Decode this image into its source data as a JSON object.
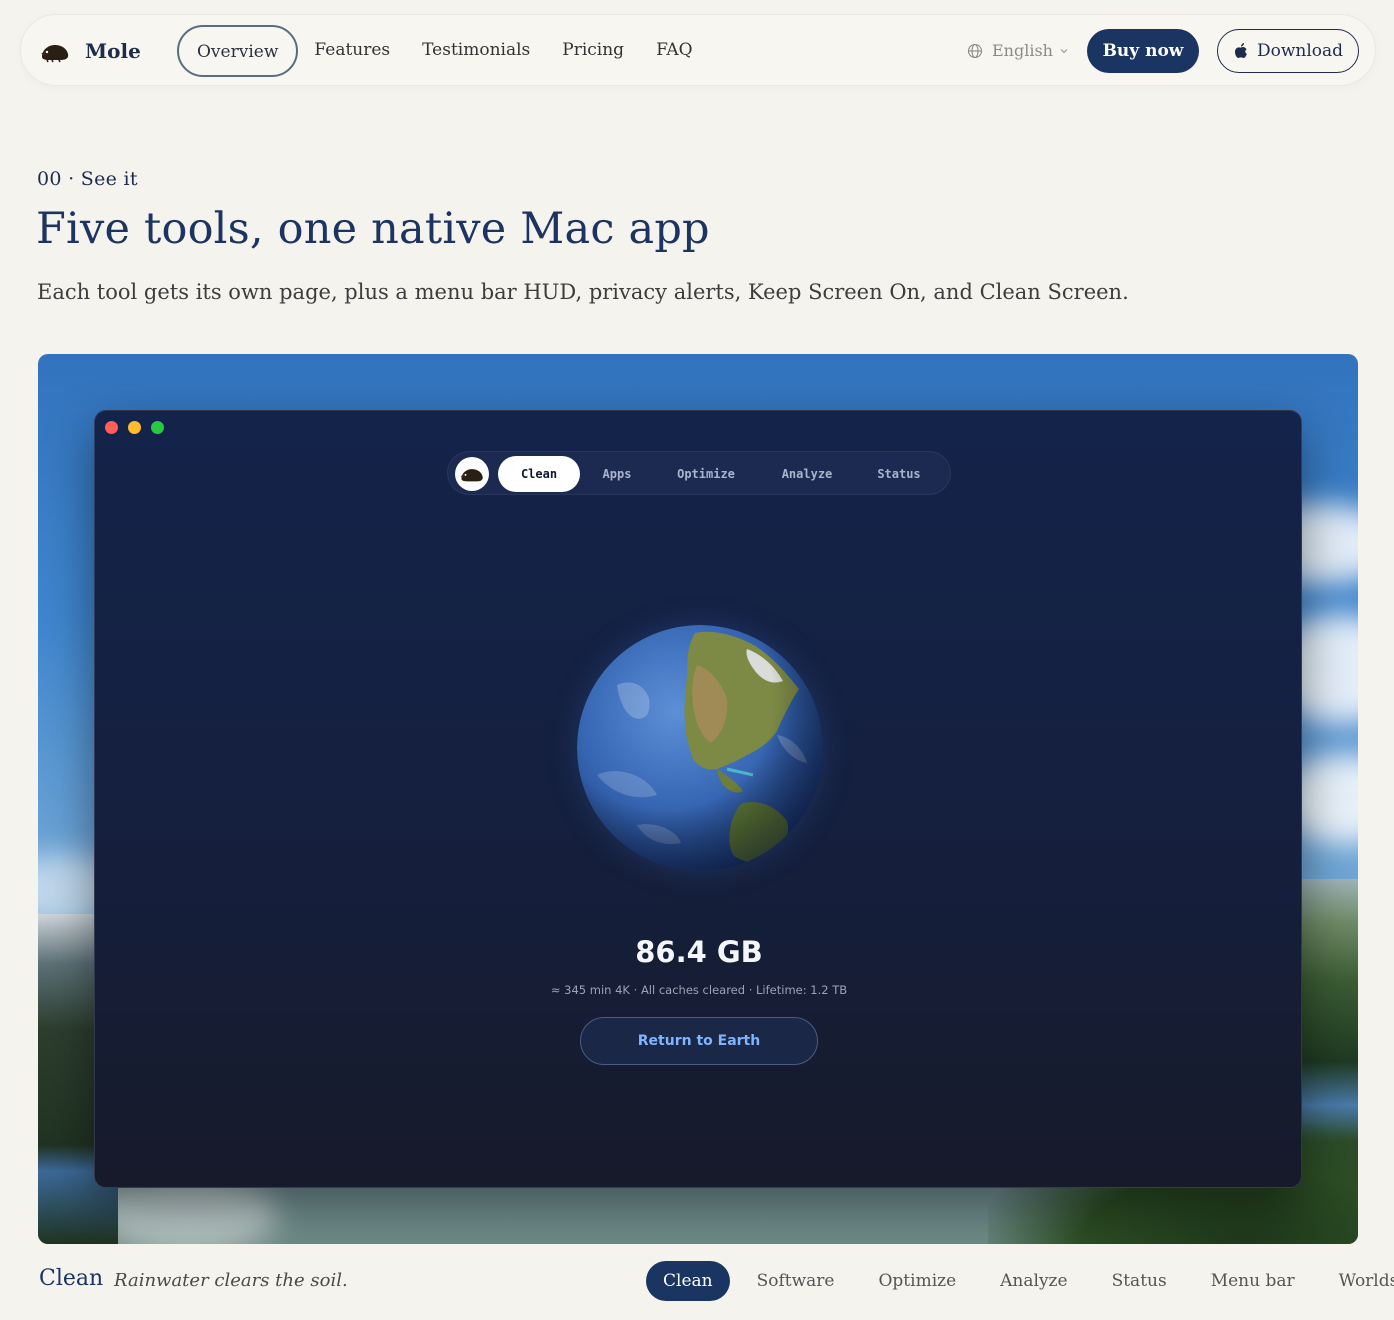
{
  "brand": {
    "name": "Mole",
    "logo_icon": "mole-icon"
  },
  "nav": {
    "links": [
      "Overview",
      "Features",
      "Testimonials",
      "Pricing",
      "FAQ"
    ],
    "active": "Overview",
    "language": "English",
    "buy_label": "Buy now",
    "download_label": "Download"
  },
  "hero": {
    "eyebrow": "00 · See it",
    "title": "Five tools, one native Mac app",
    "subtitle": "Each tool gets its own page, plus a menu bar HUD, privacy alerts, Keep Screen On, and Clean Screen."
  },
  "app": {
    "tabs": [
      "Clean",
      "Apps",
      "Optimize",
      "Analyze",
      "Status"
    ],
    "active_tab": "Clean",
    "freed_value": "86.4 GB",
    "freed_detail": "≈ 345 min 4K · All caches cleared · Lifetime: 1.2 TB",
    "return_label": "Return to Earth"
  },
  "tool_bar": {
    "current_name": "Clean",
    "current_tagline": "Rainwater clears the soil.",
    "tabs": [
      "Clean",
      "Software",
      "Optimize",
      "Analyze",
      "Status",
      "Menu bar",
      "Worlds"
    ],
    "active": "Clean"
  },
  "colors": {
    "accent": "#1b3562",
    "background": "#f5f3ee",
    "app_window": "#15203f",
    "link_blue": "#7fb4ff"
  }
}
